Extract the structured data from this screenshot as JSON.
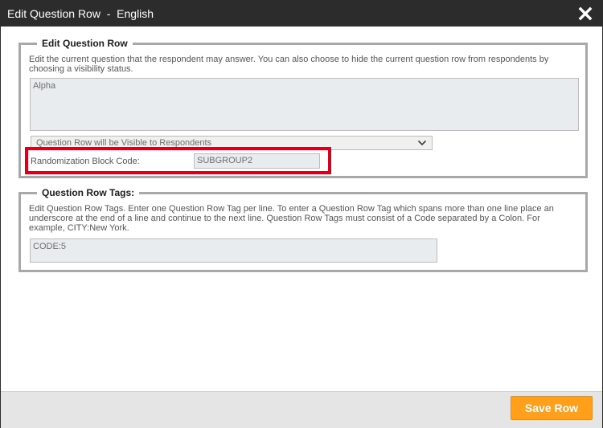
{
  "dialog": {
    "title": "Edit Question Row  -  English",
    "close_icon": "close-icon"
  },
  "edit_section": {
    "legend": "Edit Question Row",
    "description": "Edit the current question that the respondent may answer. You can also choose to hide the current question row from respondents by choosing a visibility status.",
    "question_text_value": "Alpha",
    "visibility_selected": "Question Row will be Visible to Respondents",
    "randomization_label": "Randomization Block Code:",
    "randomization_value": "SUBGROUP2"
  },
  "tags_section": {
    "legend": "Question Row Tags:",
    "description": "Edit Question Row Tags. Enter one Question Row Tag per line. To enter a Question Row Tag which spans more than one line place an underscore at the end of a line and continue to the next line. Question Row Tags must consist of a Code separated by a Colon. For example, CITY:New York.",
    "tags_value": "CODE:5"
  },
  "footer": {
    "save_label": "Save Row"
  },
  "colors": {
    "titlebar": "#2c2c2c",
    "highlight": "#d9001b",
    "save_button": "#ff9f1a",
    "footer": "#e5e5e5"
  }
}
